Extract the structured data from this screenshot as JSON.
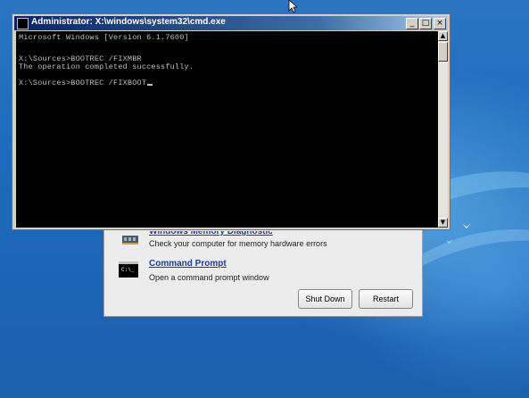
{
  "cmd_window": {
    "title": "Administrator: X:\\windows\\system32\\cmd.exe",
    "lines": [
      "Microsoft Windows [Version 6.1.7600]",
      "",
      "X:\\Sources>BOOTREC /FIXMBR",
      "The operation completed successfully.",
      "",
      "X:\\Sources>BOOTREC /FIXBOOT"
    ],
    "controls": {
      "minimize": "_",
      "maximize": "□",
      "close": "×"
    }
  },
  "recovery": {
    "options": [
      {
        "title": "Windows Memory Diagnostic",
        "description": "Check your computer for memory hardware errors",
        "icon": "memory-chip-icon"
      },
      {
        "title": "Command Prompt",
        "description": "Open a command prompt window",
        "icon": "command-prompt-icon"
      }
    ],
    "shutdown_label": "Shut Down",
    "restart_label": "Restart"
  }
}
